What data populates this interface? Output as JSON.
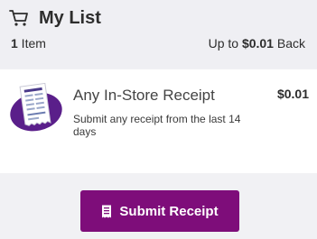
{
  "header": {
    "title": "My List",
    "item_count": "1",
    "item_label": " Item",
    "upto_prefix": "Up to ",
    "upto_amount": "$0.01",
    "upto_suffix": " Back",
    "icon": "cart-icon"
  },
  "offer": {
    "title": "Any In-Store Receipt",
    "description": "Submit any receipt from the last 14 days",
    "amount": "$0.01",
    "icon": "receipt-illustration-icon"
  },
  "actions": {
    "submit_label": "Submit Receipt",
    "submit_icon": "receipt-icon"
  },
  "colors": {
    "accent": "#7e0d7a",
    "background": "#f1f1f4",
    "card": "#ffffff"
  }
}
